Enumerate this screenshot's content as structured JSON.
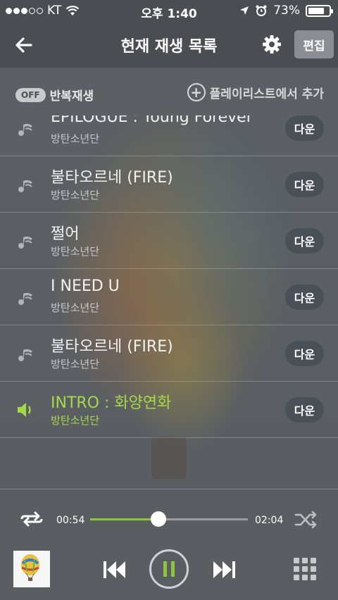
{
  "status_bar": {
    "carrier": "KT",
    "time": "오후 1:40",
    "battery": "73%",
    "signal_strength": 3
  },
  "header": {
    "title": "현재 재생 목록",
    "edit_label": "편집",
    "back_icon": "back-arrow-icon",
    "settings_icon": "gear-icon"
  },
  "controls": {
    "repeat_state": "OFF",
    "repeat_label": "반복재생",
    "add_to_playlist_label": "플레이리스트에서 추가"
  },
  "playlist": {
    "down_label": "다운",
    "items": [
      {
        "title": "EPILOGUE : Young Forever",
        "artist": "방탄소년단",
        "active": false
      },
      {
        "title": "불타오르네 (FIRE)",
        "artist": "방탄소년단",
        "active": false
      },
      {
        "title": "쩔어",
        "artist": "방탄소년단",
        "active": false
      },
      {
        "title": "I NEED U",
        "artist": "방탄소년단",
        "active": false
      },
      {
        "title": "불타오르네 (FIRE)",
        "artist": "방탄소년단",
        "active": false
      },
      {
        "title": "INTRO : 화양연화",
        "artist": "방탄소년단",
        "active": true
      }
    ]
  },
  "player": {
    "current_time": "00:54",
    "total_time": "02:04",
    "progress": 0.435,
    "accent_color": "#8cc63f"
  }
}
